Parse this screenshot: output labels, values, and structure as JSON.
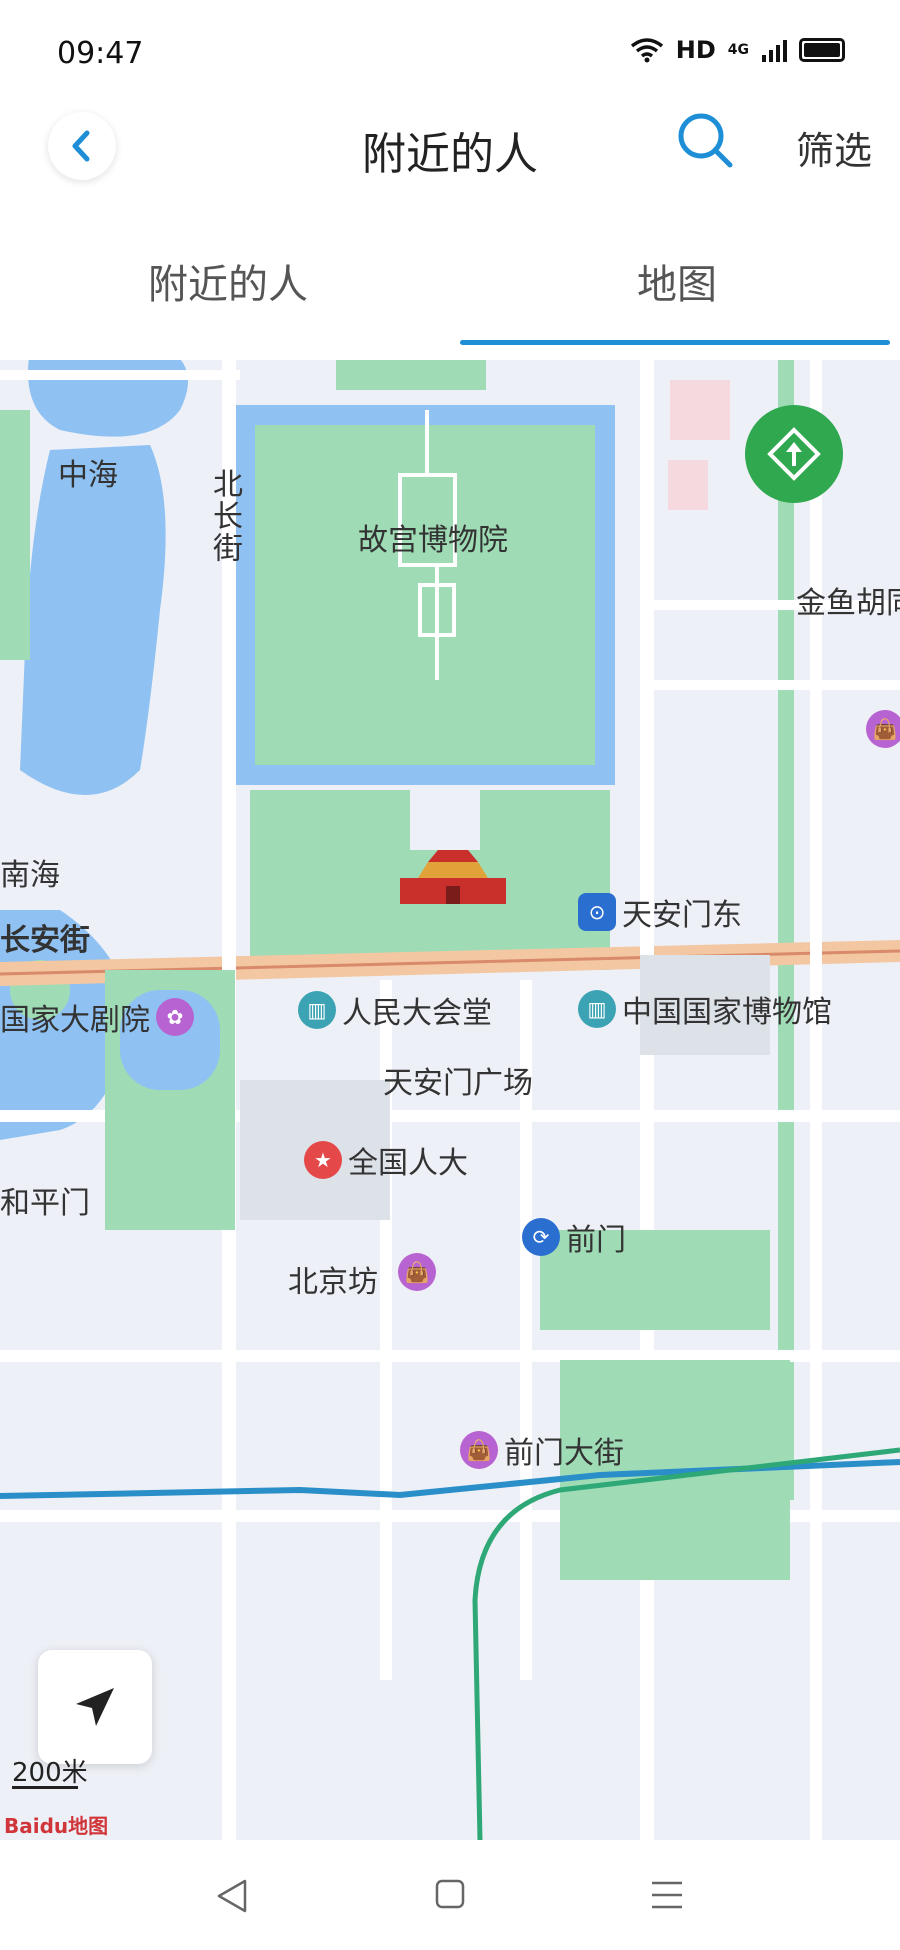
{
  "status_bar": {
    "time": "09:47",
    "network": "HD",
    "signal": "4G"
  },
  "header": {
    "title": "附近的人",
    "filter_label": "筛选",
    "back_icon": "chevron-left-icon",
    "search_icon": "search-icon"
  },
  "tabs": [
    {
      "label": "附近的人",
      "selected": false
    },
    {
      "label": "地图",
      "selected": true
    }
  ],
  "map": {
    "labels": {
      "zhonghai": "中海",
      "beichangjie": "北长街",
      "gugong": "故宫博物院",
      "jinyuhutong": "金鱼胡同",
      "nanhai": "南海",
      "changanjie": "长安街",
      "tiananmen_square": "天安门广场",
      "beijingfang": "北京坊",
      "heping_men": "和平门",
      "qianmen_street": "前门大街"
    },
    "pois": {
      "tiananmen_east": "天安门东",
      "national_theater": "国家大剧院",
      "great_hall": "人民大会堂",
      "national_museum": "中国国家博物馆",
      "npc": "全国人大",
      "qianmen": "前门",
      "qianmen_dajie": "前门大街"
    },
    "scale": "200米",
    "logo": "Baidu地图"
  },
  "colors": {
    "accent": "#1e8fd6",
    "park": "#9fdcb6",
    "water": "#8fc1f2",
    "road": "#ffffff",
    "metro": "#2a8fc8"
  }
}
